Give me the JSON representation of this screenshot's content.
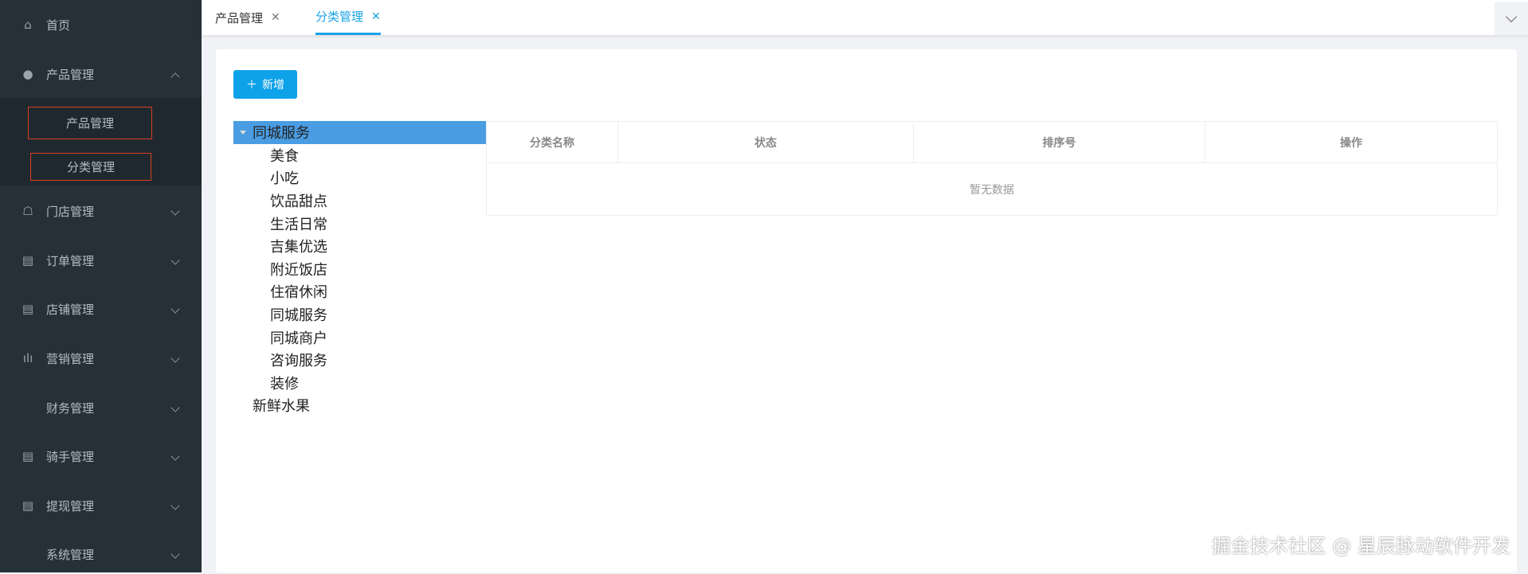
{
  "sidebar": {
    "items": [
      {
        "label": "首页",
        "icon": "home-icon"
      },
      {
        "label": "产品管理",
        "icon": "user-icon",
        "expanded": true,
        "children": [
          {
            "label": "产品管理"
          },
          {
            "label": "分类管理"
          }
        ]
      },
      {
        "label": "门店管理",
        "icon": "store-icon"
      },
      {
        "label": "订单管理",
        "icon": "document-icon"
      },
      {
        "label": "店铺管理",
        "icon": "document-icon"
      },
      {
        "label": "营销管理",
        "icon": "bar-chart-icon"
      },
      {
        "label": "财务管理",
        "icon": ""
      },
      {
        "label": "骑手管理",
        "icon": "document-icon"
      },
      {
        "label": "提现管理",
        "icon": "document-icon"
      },
      {
        "label": "系统管理",
        "icon": ""
      }
    ]
  },
  "tabs": [
    {
      "label": "产品管理",
      "active": false
    },
    {
      "label": "分类管理",
      "active": true
    }
  ],
  "toolbar": {
    "add_label": "新增"
  },
  "tree": {
    "root": "同城服务",
    "children": [
      "美食",
      "小吃",
      "饮品甜点",
      "生活日常",
      "吉集优选",
      "附近饭店",
      "住宿休闲",
      "同城服务",
      "同城商户",
      "咨询服务",
      "装修"
    ],
    "siblings": [
      "新鲜水果"
    ]
  },
  "table": {
    "columns": [
      "分类名称",
      "状态",
      "排序号",
      "操作"
    ],
    "empty_text": "暂无数据"
  },
  "watermark": "掘金技术社区 @ 星辰脉动软件开发",
  "colors": {
    "sidebar": "#263038",
    "accent": "#0ea2e8",
    "tree_selected": "#4a9de3",
    "highlight_box": "#d9401e"
  }
}
